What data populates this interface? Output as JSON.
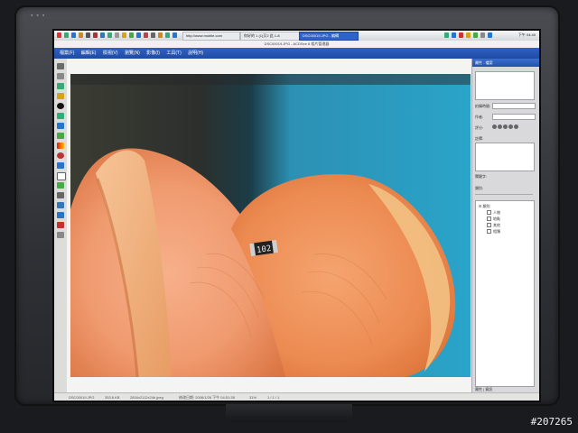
{
  "watermark": "#207265",
  "taskbar": {
    "tabs": [
      "http://www.mobile.com",
      "你好的 1 (1)又2 此 1-8",
      "DSC00019.JPG - 編輯"
    ],
    "clock": "下午 04:40"
  },
  "photo_viewer": {
    "title": "DSC00019.JPG - ACDSee 8 相片管理器",
    "menu": [
      "檔案(F)",
      "編輯(E)",
      "檢視(V)",
      "瀏覽(N)",
      "影像(I)",
      "工具(T)",
      "說明(H)"
    ],
    "component_marking": "102",
    "status": {
      "filename": "DSC00019.JPG",
      "size": "353.6 KB",
      "dimensions": "2816x2112x24b jpeg",
      "date": "修改日期: 2006/1/26 下午 04:51:38",
      "zoom": "31%",
      "page": "1 / 1 / 1"
    }
  },
  "panel": {
    "header": "屬性 - 檔案",
    "fields": [
      "拍攝時間:",
      "作者:",
      "評分:",
      "註釋:"
    ],
    "keyword_label": "關鍵字:",
    "category_label": "類別:",
    "tree": {
      "root": "類別",
      "items": [
        "人物",
        "地點",
        "其他",
        "相簿"
      ]
    },
    "footer": "屬性 | 資訊"
  },
  "colors": {
    "bezel": "#2f3136",
    "menubar": "#2450a8",
    "skin": "#f0a378",
    "background_cyan": "#2aa0c6"
  }
}
